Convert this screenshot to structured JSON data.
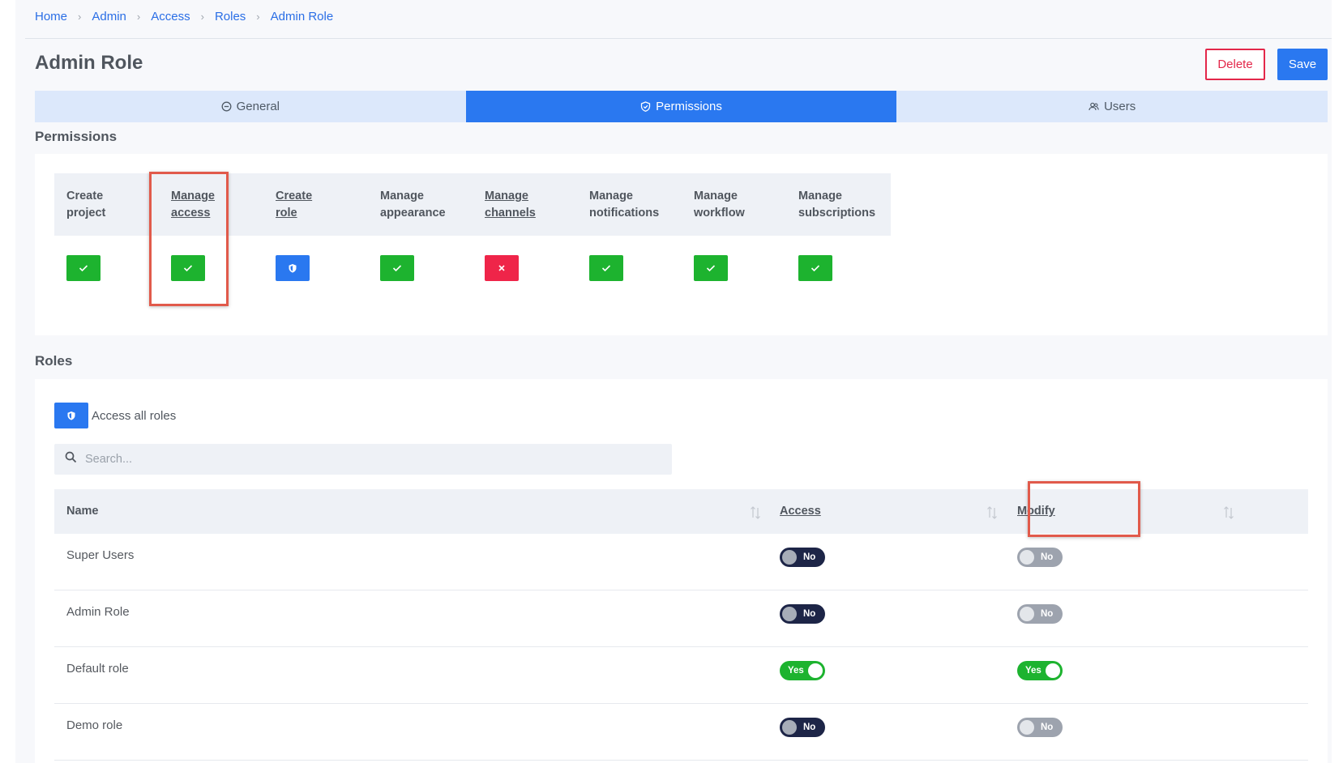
{
  "breadcrumb": [
    "Home",
    "Admin",
    "Access",
    "Roles",
    "Admin Role"
  ],
  "page_title": "Admin Role",
  "buttons": {
    "delete": "Delete",
    "save": "Save"
  },
  "tabs": [
    {
      "label": "General",
      "icon": "minus-circle-icon",
      "active": false
    },
    {
      "label": "Permissions",
      "icon": "shield-check-icon",
      "active": true
    },
    {
      "label": "Users",
      "icon": "users-icon",
      "active": false
    }
  ],
  "permissions": {
    "title": "Permissions",
    "columns": [
      {
        "line1": "Create",
        "line2": "project",
        "underlined": false,
        "state": "granted"
      },
      {
        "line1": "Manage",
        "line2": "access",
        "underlined": true,
        "state": "granted"
      },
      {
        "line1": "Create",
        "line2": "role",
        "underlined": true,
        "state": "partial"
      },
      {
        "line1": "Manage",
        "line2": "appearance",
        "underlined": false,
        "state": "granted"
      },
      {
        "line1": "Manage",
        "line2": "channels",
        "underlined": true,
        "state": "denied"
      },
      {
        "line1": "Manage",
        "line2": "notifications",
        "underlined": false,
        "state": "granted"
      },
      {
        "line1": "Manage",
        "line2": "workflow",
        "underlined": false,
        "state": "granted"
      },
      {
        "line1": "Manage",
        "line2": "subscriptions",
        "underlined": false,
        "state": "granted"
      }
    ]
  },
  "roles": {
    "title": "Roles",
    "access_all_label": "Access all roles",
    "search_placeholder": "Search...",
    "headers": {
      "name": "Name",
      "access": "Access",
      "modify": "Modify"
    },
    "rows": [
      {
        "name": "Super Users",
        "access": "No",
        "modify": "No"
      },
      {
        "name": "Admin Role",
        "access": "No",
        "modify": "No"
      },
      {
        "name": "Default role",
        "access": "Yes",
        "modify": "Yes"
      },
      {
        "name": "Demo role",
        "access": "No",
        "modify": "No"
      }
    ]
  },
  "colors": {
    "primary": "#2a78f0",
    "success": "#1db32f",
    "danger": "#e3274a",
    "toggle_dark": "#1d2547"
  }
}
